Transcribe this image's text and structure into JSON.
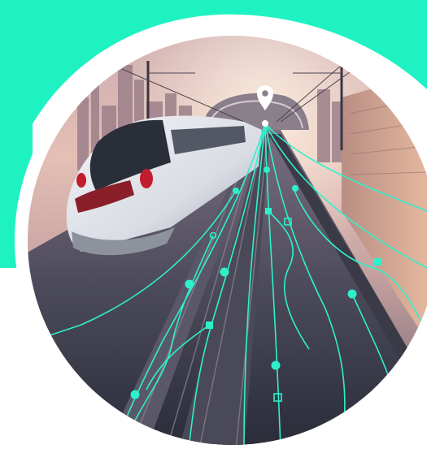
{
  "scene": {
    "subject": "high-speed-train",
    "accent_color": "#1ff2c2",
    "route_line_color": "#2ff0cc",
    "sky_top_color": "#d8b7b0",
    "sky_horizon_color": "#e9c6b2",
    "train_body_color": "#e6e8ee",
    "location_pin_icon": "map-pin-icon"
  }
}
